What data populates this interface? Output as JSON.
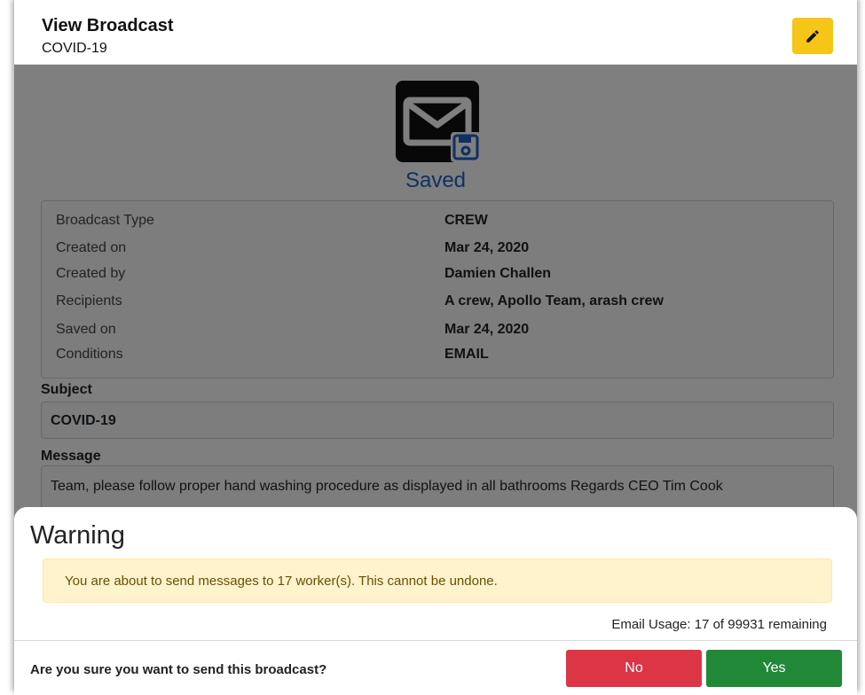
{
  "header": {
    "title": "View Broadcast",
    "subtitle": "COVID-19",
    "edit_icon": "pencil-icon",
    "edit_color": "#f5c518"
  },
  "status": {
    "icon": "envelope-save-icon",
    "label": "Saved",
    "color": "#1e63c4"
  },
  "info": {
    "rows": [
      {
        "label": "Broadcast Type",
        "value": "CREW"
      },
      {
        "label": "Created on",
        "value": "Mar 24, 2020"
      },
      {
        "label": "Created by",
        "value": "Damien Challen"
      },
      {
        "label": "Recipients",
        "value": "A crew, Apollo Team, arash crew"
      },
      {
        "label": "Saved on",
        "value": "Mar 24, 2020"
      },
      {
        "label": "Conditions",
        "value": "EMAIL"
      }
    ]
  },
  "subject": {
    "label": "Subject",
    "value": "COVID-19"
  },
  "message": {
    "label": "Message",
    "value": "Team, please follow proper hand washing procedure as displayed in all bathrooms Regards CEO Tim Cook"
  },
  "warning": {
    "title": "Warning",
    "alert": "You are about to send messages to 17 worker(s). This cannot be undone.",
    "usage": "Email Usage: 17 of 99931 remaining",
    "question": "Are you sure you want to send this broadcast?",
    "no_label": "No",
    "yes_label": "Yes",
    "no_color": "#dc3545",
    "yes_color": "#218838"
  }
}
